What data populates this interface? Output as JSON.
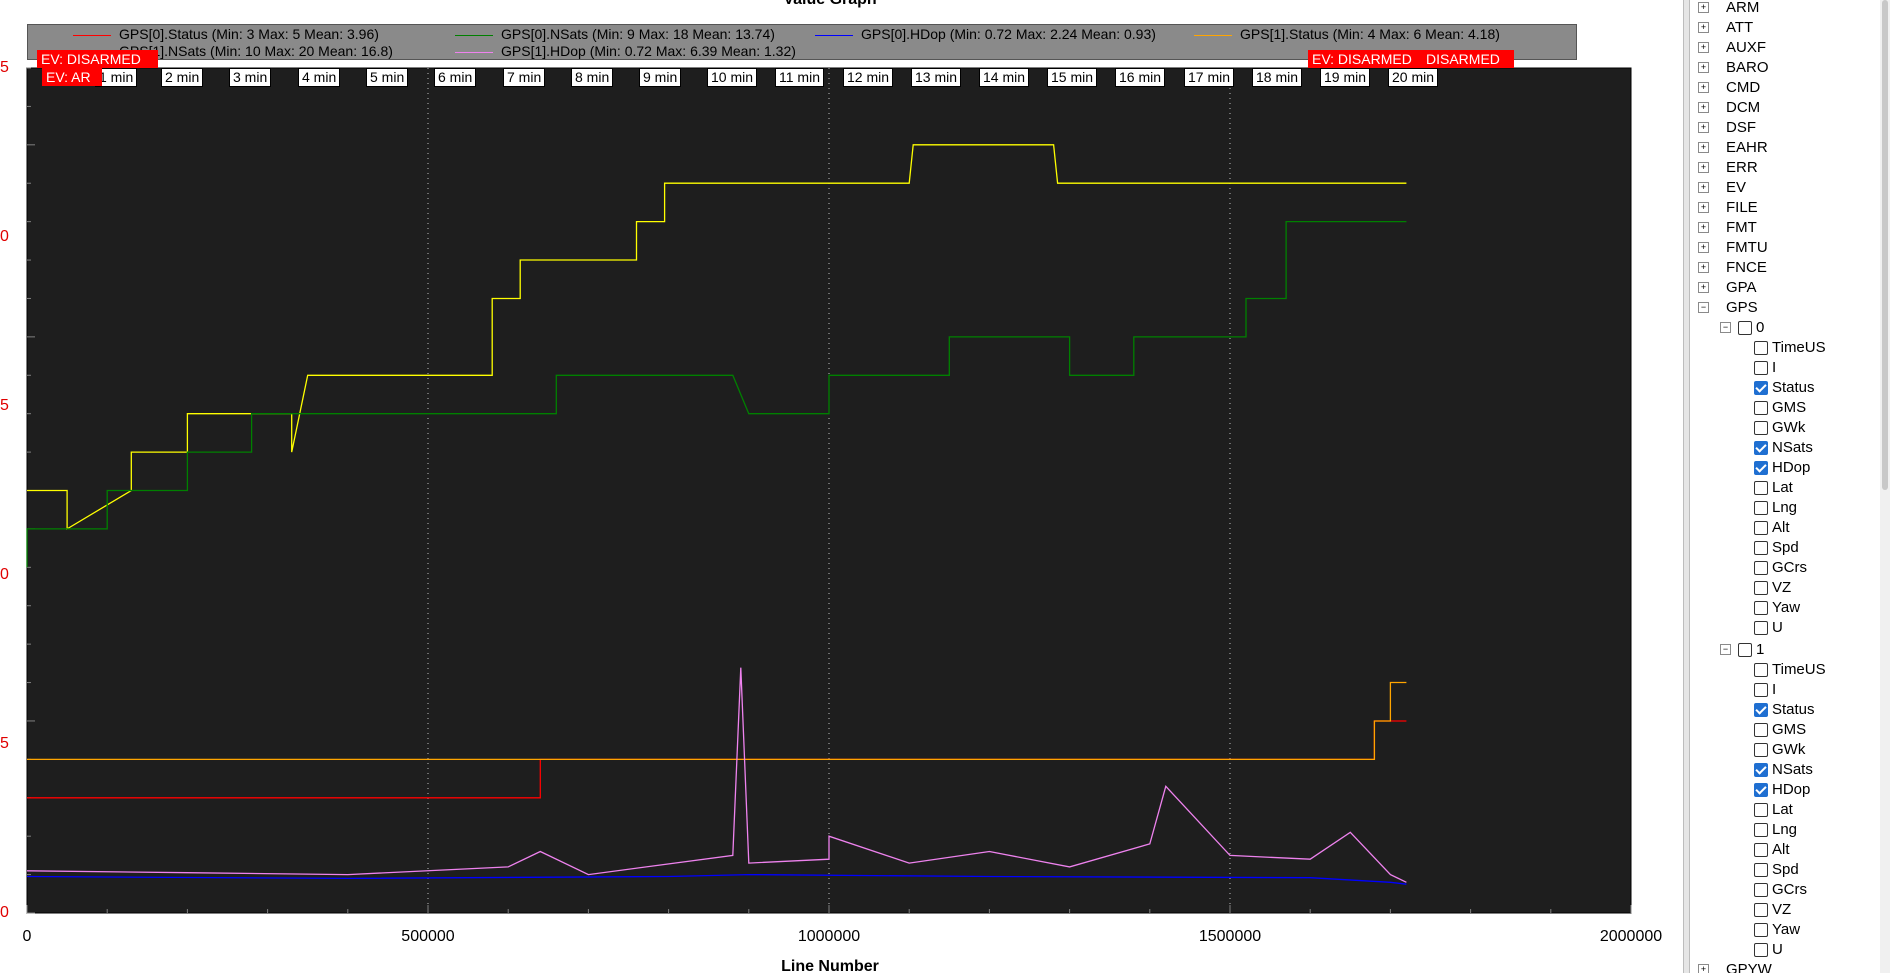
{
  "graph": {
    "title": "Value Graph",
    "xlabel": "Line Number",
    "x_ticks": [
      "0",
      "500000",
      "1000000",
      "1500000",
      "2000000"
    ],
    "y_ticks": [
      "5",
      "0",
      "5",
      "0",
      "5",
      "0"
    ],
    "legend": [
      {
        "label": "GPS[0].Status  (Min: 3 Max: 5 Mean: 3.96)",
        "color": "#ff0000"
      },
      {
        "label": "GPS[0].NSats  (Min: 9 Max: 18 Mean: 13.74)",
        "color": "#008000"
      },
      {
        "label": "GPS[0].HDop  (Min: 0.72 Max: 2.24 Mean: 0.93)",
        "color": "#0000ff"
      },
      {
        "label": "GPS[1].Status  (Min: 4 Max: 6 Mean: 4.18)",
        "color": "#ffa500"
      },
      {
        "label": "GPS[1].NSats  (Min: 10 Max: 20 Mean: 16.8)",
        "color": "#ffff00"
      },
      {
        "label": "GPS[1].HDop  (Min: 0.72 Max: 6.39 Mean: 1.32)",
        "color": "#ee82ee"
      }
    ],
    "minute_markers": [
      "1 min",
      "2 min",
      "3 min",
      "4 min",
      "5 min",
      "6 min",
      "7 min",
      "8 min",
      "9 min",
      "10 min",
      "11 min",
      "12 min",
      "13 min",
      "14 min",
      "15 min",
      "16 min",
      "17 min",
      "18 min",
      "19 min",
      "20 min"
    ],
    "events": [
      "EV: DISARMED",
      "EV: AR",
      "EV: DISARMED",
      "DISARMED"
    ],
    "colors": {
      "plot_bg": "#1e1e1e",
      "frame": "#000000",
      "axis_text": "#e00000"
    }
  },
  "chart_data": {
    "type": "line",
    "xlabel": "Line Number",
    "ylabel": "",
    "xlim": [
      0,
      2000000
    ],
    "ylim": [
      0,
      22
    ],
    "grid": "vertical dotted every 500000",
    "legend_position": "top",
    "series": [
      {
        "name": "GPS[1].NSats",
        "color": "#ffff00",
        "points": [
          [
            0,
            11
          ],
          [
            50000,
            11
          ],
          [
            50000,
            10
          ],
          [
            130000,
            11
          ],
          [
            130000,
            12
          ],
          [
            200000,
            12
          ],
          [
            200000,
            13
          ],
          [
            330000,
            13
          ],
          [
            330000,
            12
          ],
          [
            350000,
            14
          ],
          [
            580000,
            14
          ],
          [
            580000,
            16
          ],
          [
            615000,
            16
          ],
          [
            615000,
            17
          ],
          [
            760000,
            17
          ],
          [
            760000,
            18
          ],
          [
            795000,
            18
          ],
          [
            795000,
            19
          ],
          [
            1100000,
            19
          ],
          [
            1105000,
            20
          ],
          [
            1280000,
            20
          ],
          [
            1285000,
            19
          ],
          [
            1720000,
            19
          ]
        ]
      },
      {
        "name": "GPS[0].NSats",
        "color": "#008000",
        "points": [
          [
            0,
            9
          ],
          [
            0,
            10
          ],
          [
            100000,
            10
          ],
          [
            100000,
            11
          ],
          [
            200000,
            11
          ],
          [
            200000,
            12
          ],
          [
            280000,
            12
          ],
          [
            280000,
            13
          ],
          [
            480000,
            13
          ],
          [
            500000,
            13
          ],
          [
            660000,
            13
          ],
          [
            660000,
            14
          ],
          [
            880000,
            14
          ],
          [
            900000,
            13
          ],
          [
            1000000,
            13
          ],
          [
            1000000,
            14
          ],
          [
            1150000,
            14
          ],
          [
            1150000,
            15
          ],
          [
            1300000,
            15
          ],
          [
            1300000,
            14
          ],
          [
            1380000,
            14
          ],
          [
            1380000,
            15
          ],
          [
            1520000,
            15
          ],
          [
            1520000,
            16
          ],
          [
            1570000,
            16
          ],
          [
            1570000,
            18
          ],
          [
            1720000,
            18
          ]
        ]
      },
      {
        "name": "GPS[0].Status",
        "color": "#ff0000",
        "points": [
          [
            0,
            3
          ],
          [
            640000,
            3
          ],
          [
            640000,
            4
          ],
          [
            1680000,
            4
          ],
          [
            1680000,
            5
          ],
          [
            1720000,
            5
          ]
        ]
      },
      {
        "name": "GPS[1].Status",
        "color": "#ffa500",
        "points": [
          [
            0,
            4
          ],
          [
            1680000,
            4
          ],
          [
            1680000,
            5
          ],
          [
            1700000,
            5
          ],
          [
            1700000,
            6
          ],
          [
            1720000,
            6
          ]
        ]
      },
      {
        "name": "GPS[1].HDop",
        "color": "#ee82ee",
        "points": [
          [
            0,
            1.1
          ],
          [
            200000,
            1.05
          ],
          [
            400000,
            1.0
          ],
          [
            600000,
            1.2
          ],
          [
            640000,
            1.6
          ],
          [
            700000,
            1.0
          ],
          [
            880000,
            1.5
          ],
          [
            890000,
            6.39
          ],
          [
            900000,
            1.3
          ],
          [
            1000000,
            1.4
          ],
          [
            1000000,
            2.0
          ],
          [
            1100000,
            1.3
          ],
          [
            1200000,
            1.6
          ],
          [
            1300000,
            1.2
          ],
          [
            1400000,
            1.8
          ],
          [
            1420000,
            3.3
          ],
          [
            1500000,
            1.5
          ],
          [
            1600000,
            1.4
          ],
          [
            1650000,
            2.1
          ],
          [
            1700000,
            1.0
          ],
          [
            1720000,
            0.8
          ]
        ]
      },
      {
        "name": "GPS[0].HDop",
        "color": "#0000ff",
        "points": [
          [
            0,
            0.95
          ],
          [
            400000,
            0.9
          ],
          [
            800000,
            0.95
          ],
          [
            900000,
            1.0
          ],
          [
            1200000,
            0.95
          ],
          [
            1600000,
            0.92
          ],
          [
            1700000,
            0.8
          ],
          [
            1720000,
            0.75
          ]
        ]
      }
    ]
  },
  "tree": {
    "top_items": [
      "ARM",
      "ATT",
      "AUXF",
      "BARO",
      "CMD",
      "DCM",
      "DSF",
      "EAHR",
      "ERR",
      "EV",
      "FILE",
      "FMT",
      "FMTU",
      "FNCE",
      "GPA"
    ],
    "gps_label": "GPS",
    "gps_children": [
      {
        "label": "0",
        "fields": [
          {
            "label": "TimeUS",
            "checked": false
          },
          {
            "label": "I",
            "checked": false
          },
          {
            "label": "Status",
            "checked": true
          },
          {
            "label": "GMS",
            "checked": false
          },
          {
            "label": "GWk",
            "checked": false
          },
          {
            "label": "NSats",
            "checked": true
          },
          {
            "label": "HDop",
            "checked": true
          },
          {
            "label": "Lat",
            "checked": false
          },
          {
            "label": "Lng",
            "checked": false
          },
          {
            "label": "Alt",
            "checked": false
          },
          {
            "label": "Spd",
            "checked": false
          },
          {
            "label": "GCrs",
            "checked": false
          },
          {
            "label": "VZ",
            "checked": false
          },
          {
            "label": "Yaw",
            "checked": false
          },
          {
            "label": "U",
            "checked": false
          }
        ]
      },
      {
        "label": "1",
        "fields": [
          {
            "label": "TimeUS",
            "checked": false
          },
          {
            "label": "I",
            "checked": false
          },
          {
            "label": "Status",
            "checked": true
          },
          {
            "label": "GMS",
            "checked": false
          },
          {
            "label": "GWk",
            "checked": false
          },
          {
            "label": "NSats",
            "checked": true
          },
          {
            "label": "HDop",
            "checked": true
          },
          {
            "label": "Lat",
            "checked": false
          },
          {
            "label": "Lng",
            "checked": false
          },
          {
            "label": "Alt",
            "checked": false
          },
          {
            "label": "Spd",
            "checked": false
          },
          {
            "label": "GCrs",
            "checked": false
          },
          {
            "label": "VZ",
            "checked": false
          },
          {
            "label": "Yaw",
            "checked": false
          },
          {
            "label": "U",
            "checked": false
          }
        ]
      }
    ],
    "bottom_item": "GPYW"
  }
}
